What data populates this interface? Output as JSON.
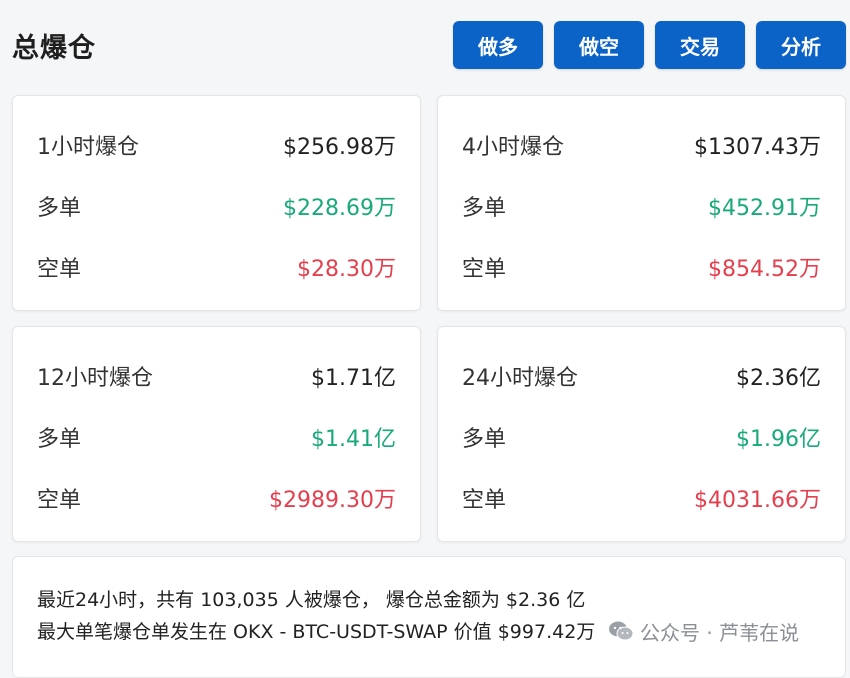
{
  "header": {
    "title": "总爆仓",
    "buttons": [
      "做多",
      "做空",
      "交易",
      "分析"
    ]
  },
  "cards": [
    {
      "rows": [
        {
          "label": "1小时爆仓",
          "value": "$256.98万"
        },
        {
          "label": "多单",
          "value": "$228.69万"
        },
        {
          "label": "空单",
          "value": "$28.30万"
        }
      ]
    },
    {
      "rows": [
        {
          "label": "4小时爆仓",
          "value": "$1307.43万"
        },
        {
          "label": "多单",
          "value": "$452.91万"
        },
        {
          "label": "空单",
          "value": "$854.52万"
        }
      ]
    },
    {
      "rows": [
        {
          "label": "12小时爆仓",
          "value": "$1.71亿"
        },
        {
          "label": "多单",
          "value": "$1.41亿"
        },
        {
          "label": "空单",
          "value": "$2989.30万"
        }
      ]
    },
    {
      "rows": [
        {
          "label": "24小时爆仓",
          "value": "$2.36亿"
        },
        {
          "label": "多单",
          "value": "$1.96亿"
        },
        {
          "label": "空单",
          "value": "$4031.66万"
        }
      ]
    }
  ],
  "summary": {
    "line1": "最近24小时，共有 103,035 人被爆仓， 爆仓总金额为 $2.36 亿",
    "line2": "最大单笔爆仓单发生在 OKX - BTC-USDT-SWAP 价值 $997.42万"
  },
  "watermark": {
    "text": "公众号 · 芦苇在说",
    "icon": "wechat-icon"
  },
  "colors": {
    "accent": "#0b62c7",
    "long": "#19a97b",
    "short": "#e53e4d"
  }
}
